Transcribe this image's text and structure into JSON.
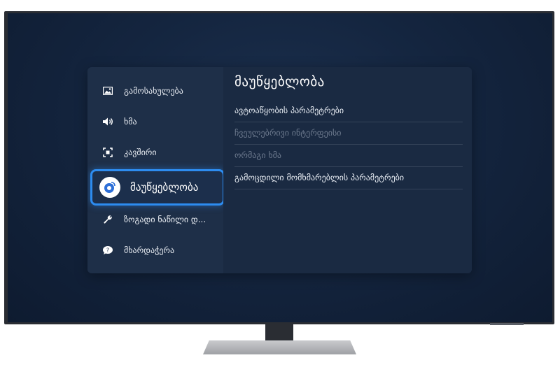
{
  "sidebar": {
    "items": [
      {
        "label": "გამოსახულება",
        "icon": "picture-icon"
      },
      {
        "label": "ხმა",
        "icon": "speaker-icon"
      },
      {
        "label": "კავშირი",
        "icon": "connection-icon"
      },
      {
        "label": "მაუწყებლობა",
        "icon": "broadcast-icon",
        "selected": true
      },
      {
        "label": "ზოგადი ნაწილი დ...",
        "icon": "wrench-icon"
      },
      {
        "label": "მხარდაჭერა",
        "icon": "support-icon"
      }
    ]
  },
  "content": {
    "title": "მაუწყებლობა",
    "items": [
      {
        "label": "ავტოაწყობის პარამეტრები",
        "enabled": true
      },
      {
        "label": "ჩვეულებრივი ინტერფეისი",
        "enabled": false
      },
      {
        "label": "ორმაგი ხმა",
        "enabled": false
      },
      {
        "label": "გამოცდილი მომხმარებლის პარამეტრები",
        "enabled": true
      }
    ]
  },
  "colors": {
    "accent": "#2d8cf0",
    "panel": "#1b2c45",
    "screen": "#14253f"
  }
}
